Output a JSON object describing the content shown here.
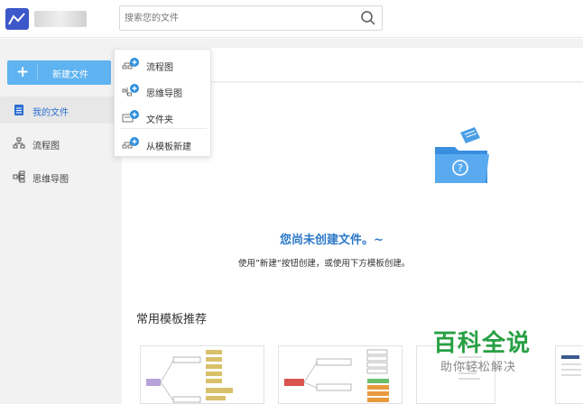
{
  "search": {
    "placeholder": "搜索您的文件"
  },
  "sidebar": {
    "new_button_label": "新建文件",
    "items": [
      {
        "label": "我的文件",
        "icon": "document-icon",
        "active": true
      },
      {
        "label": "流程图",
        "icon": "flowchart-icon"
      },
      {
        "label": "思维导图",
        "icon": "mindmap-icon"
      }
    ]
  },
  "dropdown": {
    "items": [
      {
        "label": "流程图",
        "icon": "flowchart-add-icon"
      },
      {
        "label": "思维导图",
        "icon": "mindmap-add-icon"
      },
      {
        "label": "文件夹",
        "icon": "folder-add-icon"
      },
      {
        "label": "从模板新建",
        "icon": "template-add-icon"
      }
    ]
  },
  "empty_state": {
    "title": "您尚未创建文件。~",
    "subtitle": "使用”新建“按钮创建，或使用下方模板创建。"
  },
  "templates": {
    "title": "常用模板推荐"
  },
  "watermark": {
    "title": "百科全说",
    "subtitle": "助你轻松解决"
  },
  "colors": {
    "accent": "#5eb3f0",
    "logo": "#3d58c9",
    "active_text": "#2d6fd2",
    "watermark": "#27a044"
  }
}
